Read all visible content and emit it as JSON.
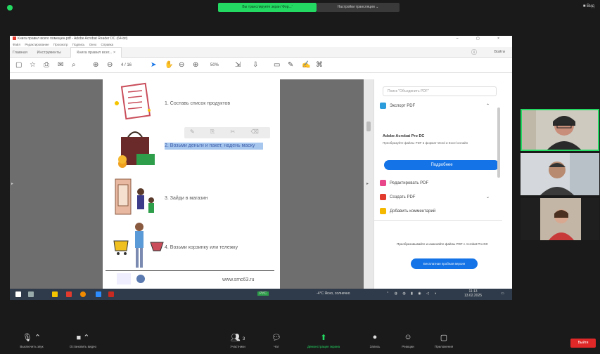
{
  "zoom": {
    "share_banner": "Вы транслируете экран 'Фор...'",
    "share_options": "Настройки трансляции ⌄",
    "view_button": "Вид",
    "bottom": [
      {
        "label": "Выключить звук",
        "icon": "microphone-icon"
      },
      {
        "label": "Остановить видео",
        "icon": "camera-icon"
      },
      {
        "label": "Участники",
        "icon": "participants-icon",
        "count": "3"
      },
      {
        "label": "Чат",
        "icon": "chat-icon"
      },
      {
        "label": "Демонстрация экрана",
        "icon": "share-screen-icon"
      },
      {
        "label": "Запись",
        "icon": "record-icon"
      },
      {
        "label": "Реакции",
        "icon": "reactions-icon"
      },
      {
        "label": "Приложения",
        "icon": "apps-icon"
      }
    ],
    "leave_button": "Выйти",
    "participants_colors": [
      "#23d962"
    ]
  },
  "acrobat": {
    "window_title": "Книга правил всего помещен.pdf - Adobe Acrobat Reader DC (64-bit)",
    "menu": [
      "Файл",
      "Редактирование",
      "Просмотр",
      "Подпись",
      "Окно",
      "Справка"
    ],
    "tabs": [
      "Главная",
      "Инструменты"
    ],
    "doc_tab": "Книга правил всег...  ×",
    "sign_in": "Войти",
    "page_indicator": "4 / 16",
    "zoom_level": "50%",
    "steps": [
      "1. Составь список продуктов",
      "2. Возьми деньги и пакет, надень маску",
      "3. Зайди в магазин",
      "4. Возьми корзинку или тележку"
    ],
    "site_url": "www.smc63.ru"
  },
  "panel": {
    "search_placeholder": "Поиск \"Объединить PDF\"",
    "export_label": "Экспорт PDF",
    "promo_title": "Adobe Acrobat Pro DC",
    "promo_text": "Преобразуйте файлы PDF в формат Word и Excel онлайн",
    "more_button": "Подробнее",
    "edit_label": "Редактировать PDF",
    "create_label": "Создать PDF",
    "comment_label": "Добавить комментарий",
    "trial_text": "Преобразовывайте и изменяйте файлы PDF с Acrobat Pro DC",
    "trial_button": "Бесплатная пробная версия",
    "colors": {
      "export": "#2d9cdb",
      "edit": "#e8488a",
      "create": "#e23b2e",
      "comment": "#f5b800",
      "accent": "#1473e6"
    }
  },
  "taskbar": {
    "weather": "-4°C Ясно, солнечно",
    "lang": "РУС",
    "time": "11:13",
    "date": "13.02.2025"
  }
}
